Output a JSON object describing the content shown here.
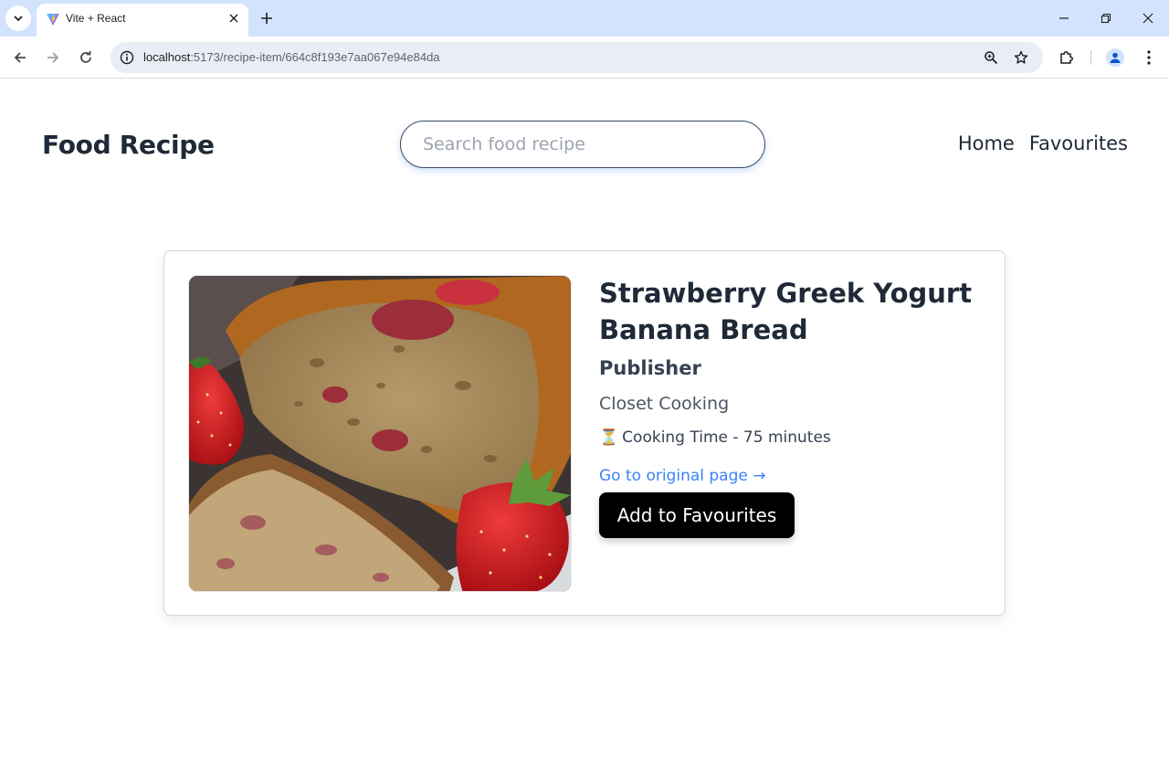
{
  "browser": {
    "tab_title": "Vite + React",
    "url_host": "localhost",
    "url_path": ":5173/recipe-item/664c8f193e7aa067e94e84da"
  },
  "header": {
    "brand": "Food Recipe",
    "search_placeholder": "Search food recipe",
    "nav": [
      "Home",
      "Favourites"
    ]
  },
  "recipe": {
    "title": "Strawberry Greek Yogurt Banana Bread",
    "publisher_label": "Publisher",
    "publisher": "Closet Cooking",
    "cooking_time_icon": "⏳",
    "cooking_time": "Cooking Time - 75 minutes",
    "original_link": "Go to original page →",
    "favourite_button": "Add to Favourites"
  },
  "colors": {
    "tabbar": "#d3e3fd",
    "link": "#3b82f6",
    "button": "#000000",
    "heading": "#1f2937"
  }
}
